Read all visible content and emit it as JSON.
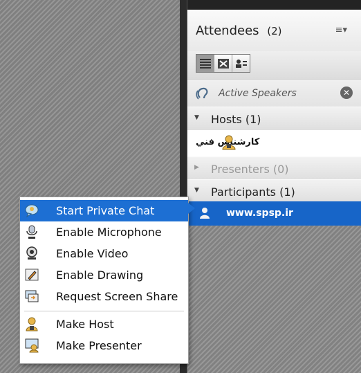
{
  "pod": {
    "title": "Attendees",
    "count": "(2)",
    "menu_icon": "≡▾"
  },
  "view_buttons": [
    {
      "icon": "list-view-icon"
    },
    {
      "icon": "breakout-icon"
    },
    {
      "icon": "status-view-icon"
    }
  ],
  "speakers": {
    "label": "Active Speakers",
    "icon": "speaker-ear-icon",
    "close_icon": "close-icon"
  },
  "sections": {
    "hosts": "Hosts (1)",
    "presenters": "Presenters (0)",
    "participants": "Participants (1)"
  },
  "host_row": {
    "name": "كارشناس فني"
  },
  "participant_row": {
    "name": "www.spsp.ir"
  },
  "context_menu": {
    "items": [
      {
        "label": "Start Private Chat",
        "icon": "chat-icon"
      },
      {
        "label": "Enable Microphone",
        "icon": "microphone-icon"
      },
      {
        "label": "Enable Video",
        "icon": "webcam-icon"
      },
      {
        "label": "Enable Drawing",
        "icon": "pencil-icon"
      },
      {
        "label": "Request Screen Share",
        "icon": "screen-share-icon"
      },
      {
        "label": "Make Host",
        "icon": "host-icon"
      },
      {
        "label": "Make Presenter",
        "icon": "presenter-icon"
      }
    ],
    "selected_index": 0
  },
  "colors": {
    "selection": "#1d6fd3",
    "participant_row": "#1765c8"
  }
}
